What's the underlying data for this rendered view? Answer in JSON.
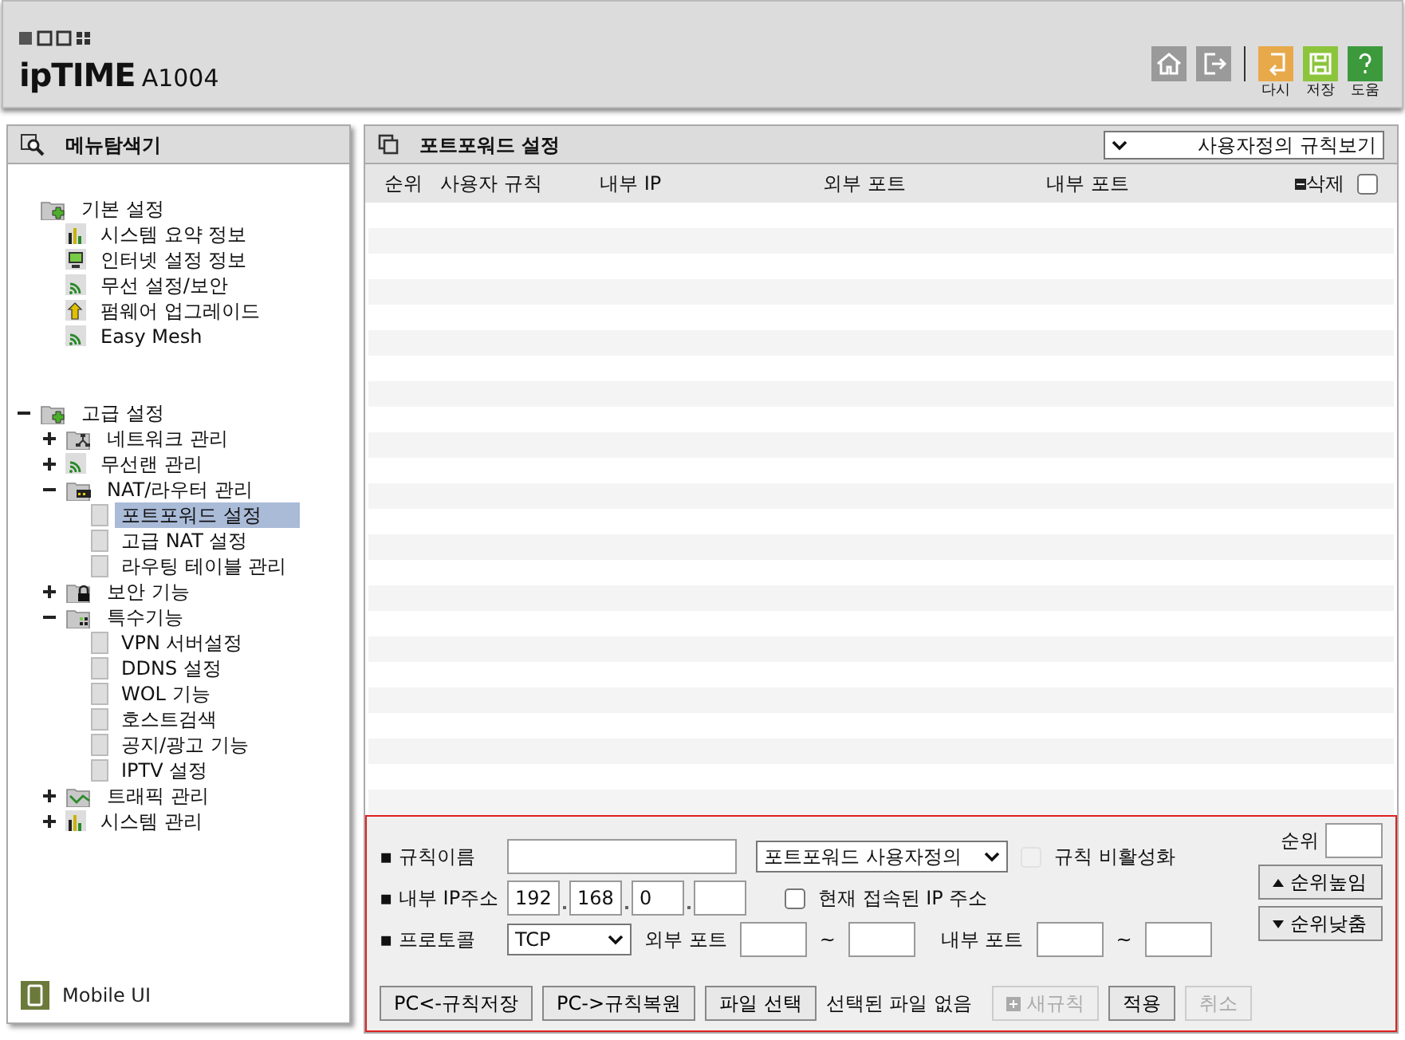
{
  "header": {
    "logo": "ipTIME",
    "model": "A1004",
    "actions": [
      {
        "kind": "home"
      },
      {
        "kind": "logout"
      },
      {
        "kind": "undo",
        "label": "다시",
        "color": "#e8a94a"
      },
      {
        "kind": "save",
        "label": "저장",
        "color": "#8cc43c"
      },
      {
        "kind": "help",
        "label": "도움",
        "color": "#3c9a3c"
      }
    ]
  },
  "sidebar": {
    "title": "메뉴탐색기",
    "footer": "Mobile UI",
    "items": [
      {
        "label": "기본 설정",
        "kind": "folder-plus",
        "selected": false,
        "children": [
          {
            "label": "시스템 요약 정보",
            "kind": "chart",
            "selected": false
          },
          {
            "label": "인터넷 설정 정보",
            "kind": "monitor",
            "selected": false
          },
          {
            "label": "무선 설정/보안",
            "kind": "wifi",
            "selected": false
          },
          {
            "label": "펌웨어 업그레이드",
            "kind": "upload",
            "selected": false
          },
          {
            "label": "Easy Mesh",
            "kind": "wifi",
            "selected": false
          }
        ]
      },
      {
        "label": "고급 설정",
        "kind": "folder-plus",
        "expanded": true,
        "selected": false,
        "children": [
          {
            "label": "네트워크 관리",
            "kind": "network",
            "expanded": false,
            "selected": false
          },
          {
            "label": "무선랜 관리",
            "kind": "wifi",
            "expanded": false,
            "selected": false
          },
          {
            "label": "NAT/라우터 관리",
            "kind": "router",
            "expanded": true,
            "selected": false,
            "children": [
              {
                "label": "포트포워드 설정",
                "kind": "page",
                "selected": true
              },
              {
                "label": "고급 NAT 설정",
                "kind": "page",
                "selected": false
              },
              {
                "label": "라우팅 테이블 관리",
                "kind": "page",
                "selected": false
              }
            ]
          },
          {
            "label": "보안 기능",
            "kind": "lock",
            "expanded": false,
            "selected": false
          },
          {
            "label": "특수기능",
            "kind": "dots",
            "expanded": true,
            "selected": false,
            "children": [
              {
                "label": "VPN 서버설정",
                "kind": "page",
                "selected": false
              },
              {
                "label": "DDNS 설정",
                "kind": "page",
                "selected": false
              },
              {
                "label": "WOL 기능",
                "kind": "page",
                "selected": false
              },
              {
                "label": "호스트검색",
                "kind": "page",
                "selected": false
              },
              {
                "label": "공지/광고 기능",
                "kind": "page",
                "selected": false
              },
              {
                "label": "IPTV 설정",
                "kind": "page",
                "selected": false
              }
            ]
          },
          {
            "label": "트래픽 관리",
            "kind": "traffic",
            "expanded": false,
            "selected": false
          },
          {
            "label": "시스템 관리",
            "kind": "chart",
            "expanded": false,
            "selected": false
          }
        ]
      }
    ]
  },
  "main": {
    "title": "포트포워드 설정",
    "view_select": "사용자정의 규칙보기",
    "table": {
      "columns": [
        "순위",
        "사용자 규칙",
        "내부 IP",
        "외부 포트",
        "내부 포트"
      ],
      "delete_label": "삭제",
      "select_all_checked": false
    },
    "form": {
      "bullet": "▪",
      "rule_name_label": "규칙이름",
      "rule_type": "포트포워드 사용자정의",
      "disable_label": "규칙 비활성화",
      "disable_checked": false,
      "disable_disabled": true,
      "ip_label": "내부 IP주소",
      "ip": [
        "192",
        "168",
        "0"
      ],
      "current_ip_label": "현재 접속된 IP 주소",
      "current_ip_checked": false,
      "protocol_label": "프로토콜",
      "protocol": "TCP",
      "ext_port_label": "외부 포트",
      "int_port_label": "내부 포트",
      "range_sep": "~",
      "order_label": "순위",
      "up_label": "순위높임",
      "down_label": "순위낮춤",
      "buttons": [
        {
          "label": "PC<-규칙저장",
          "disabled": false
        },
        {
          "label": "PC->규칙복원",
          "disabled": false
        },
        {
          "label": "파일 선택",
          "disabled": false
        }
      ],
      "file_status": "선택된 파일 없음",
      "right_buttons": [
        {
          "label": "새규칙",
          "kind": "new",
          "disabled": true
        },
        {
          "label": "적용",
          "kind": "apply",
          "disabled": false
        },
        {
          "label": "취소",
          "kind": "cancel",
          "disabled": true
        }
      ]
    }
  }
}
